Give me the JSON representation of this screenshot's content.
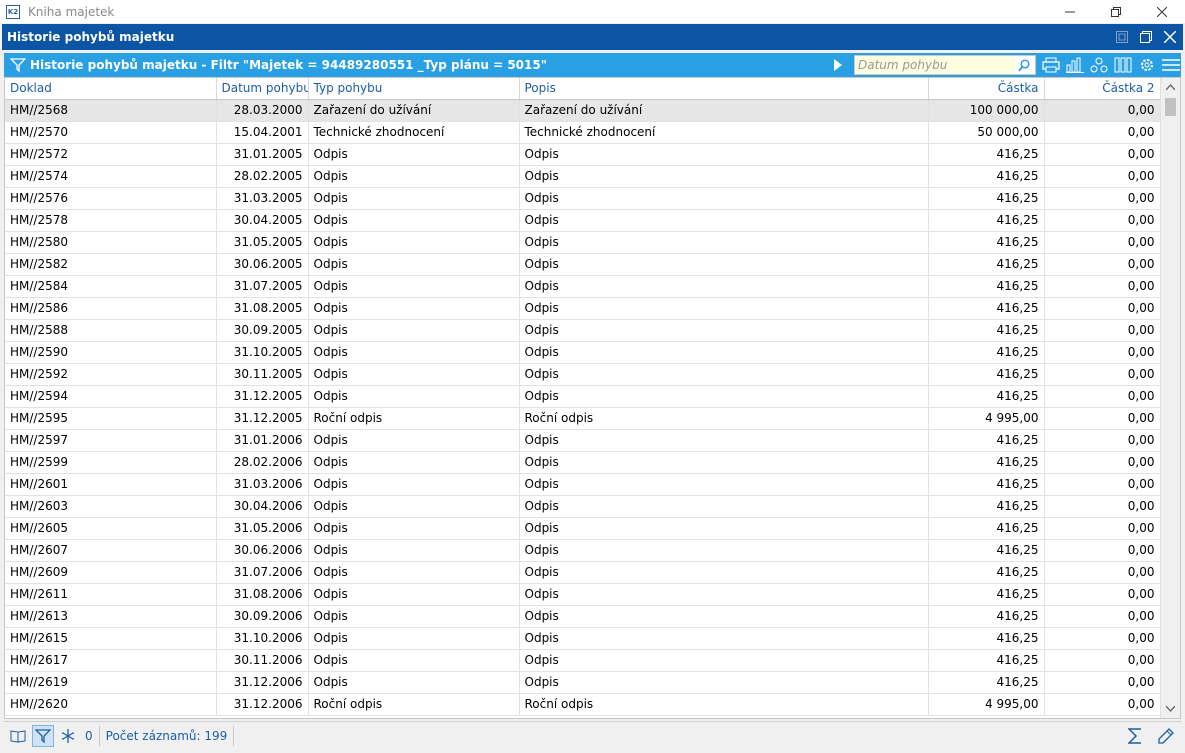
{
  "app": {
    "os_title": "Kniha majetek",
    "app_badge": "K2"
  },
  "window": {
    "title": "Historie pohybů majetku"
  },
  "filter_bar": {
    "text": "Historie pohybů majetku - Filtr \"Majetek = 94489280551 _Typ plánu = 5015\"",
    "search_placeholder": "Datum pohybu"
  },
  "grid": {
    "columns": [
      "Doklad",
      "Datum pohybu",
      "Typ pohybu",
      "Popis",
      "Částka",
      "Částka 2"
    ],
    "rows": [
      [
        "HM//2568",
        "28.03.2000",
        "Zařazení do užívání",
        "Zařazení do užívání",
        "100 000,00",
        "0,00"
      ],
      [
        "HM//2570",
        "15.04.2001",
        "Technické zhodnocení",
        "Technické zhodnocení",
        "50 000,00",
        "0,00"
      ],
      [
        "HM//2572",
        "31.01.2005",
        "Odpis",
        "Odpis",
        "416,25",
        "0,00"
      ],
      [
        "HM//2574",
        "28.02.2005",
        "Odpis",
        "Odpis",
        "416,25",
        "0,00"
      ],
      [
        "HM//2576",
        "31.03.2005",
        "Odpis",
        "Odpis",
        "416,25",
        "0,00"
      ],
      [
        "HM//2578",
        "30.04.2005",
        "Odpis",
        "Odpis",
        "416,25",
        "0,00"
      ],
      [
        "HM//2580",
        "31.05.2005",
        "Odpis",
        "Odpis",
        "416,25",
        "0,00"
      ],
      [
        "HM//2582",
        "30.06.2005",
        "Odpis",
        "Odpis",
        "416,25",
        "0,00"
      ],
      [
        "HM//2584",
        "31.07.2005",
        "Odpis",
        "Odpis",
        "416,25",
        "0,00"
      ],
      [
        "HM//2586",
        "31.08.2005",
        "Odpis",
        "Odpis",
        "416,25",
        "0,00"
      ],
      [
        "HM//2588",
        "30.09.2005",
        "Odpis",
        "Odpis",
        "416,25",
        "0,00"
      ],
      [
        "HM//2590",
        "31.10.2005",
        "Odpis",
        "Odpis",
        "416,25",
        "0,00"
      ],
      [
        "HM//2592",
        "30.11.2005",
        "Odpis",
        "Odpis",
        "416,25",
        "0,00"
      ],
      [
        "HM//2594",
        "31.12.2005",
        "Odpis",
        "Odpis",
        "416,25",
        "0,00"
      ],
      [
        "HM//2595",
        "31.12.2005",
        "Roční odpis",
        "Roční odpis",
        "4 995,00",
        "0,00"
      ],
      [
        "HM//2597",
        "31.01.2006",
        "Odpis",
        "Odpis",
        "416,25",
        "0,00"
      ],
      [
        "HM//2599",
        "28.02.2006",
        "Odpis",
        "Odpis",
        "416,25",
        "0,00"
      ],
      [
        "HM//2601",
        "31.03.2006",
        "Odpis",
        "Odpis",
        "416,25",
        "0,00"
      ],
      [
        "HM//2603",
        "30.04.2006",
        "Odpis",
        "Odpis",
        "416,25",
        "0,00"
      ],
      [
        "HM//2605",
        "31.05.2006",
        "Odpis",
        "Odpis",
        "416,25",
        "0,00"
      ],
      [
        "HM//2607",
        "30.06.2006",
        "Odpis",
        "Odpis",
        "416,25",
        "0,00"
      ],
      [
        "HM//2609",
        "31.07.2006",
        "Odpis",
        "Odpis",
        "416,25",
        "0,00"
      ],
      [
        "HM//2611",
        "31.08.2006",
        "Odpis",
        "Odpis",
        "416,25",
        "0,00"
      ],
      [
        "HM//2613",
        "30.09.2006",
        "Odpis",
        "Odpis",
        "416,25",
        "0,00"
      ],
      [
        "HM//2615",
        "31.10.2006",
        "Odpis",
        "Odpis",
        "416,25",
        "0,00"
      ],
      [
        "HM//2617",
        "30.11.2006",
        "Odpis",
        "Odpis",
        "416,25",
        "0,00"
      ],
      [
        "HM//2619",
        "31.12.2006",
        "Odpis",
        "Odpis",
        "416,25",
        "0,00"
      ],
      [
        "HM//2620",
        "31.12.2006",
        "Roční odpis",
        "Roční odpis",
        "4 995,00",
        "0,00"
      ]
    ],
    "selected_row": 0
  },
  "status_bar": {
    "mark_count": "0",
    "record_count": "Počet záznamů: 199"
  },
  "icons": {
    "os_controls": [
      "minimize-icon",
      "restore-icon",
      "close-icon"
    ],
    "window_controls": [
      "dock-icon",
      "maximize-icon",
      "close-icon"
    ],
    "toolbar": [
      "print-icon",
      "chart-icon",
      "hierarchy-icon",
      "columns-icon",
      "gear-icon",
      "menu-icon"
    ]
  },
  "colors": {
    "window_header": "#0c55a5",
    "filter_bar": "#29a0e3",
    "column_header_text": "#1c5ea8",
    "selected_row": "#e6e6e6"
  }
}
